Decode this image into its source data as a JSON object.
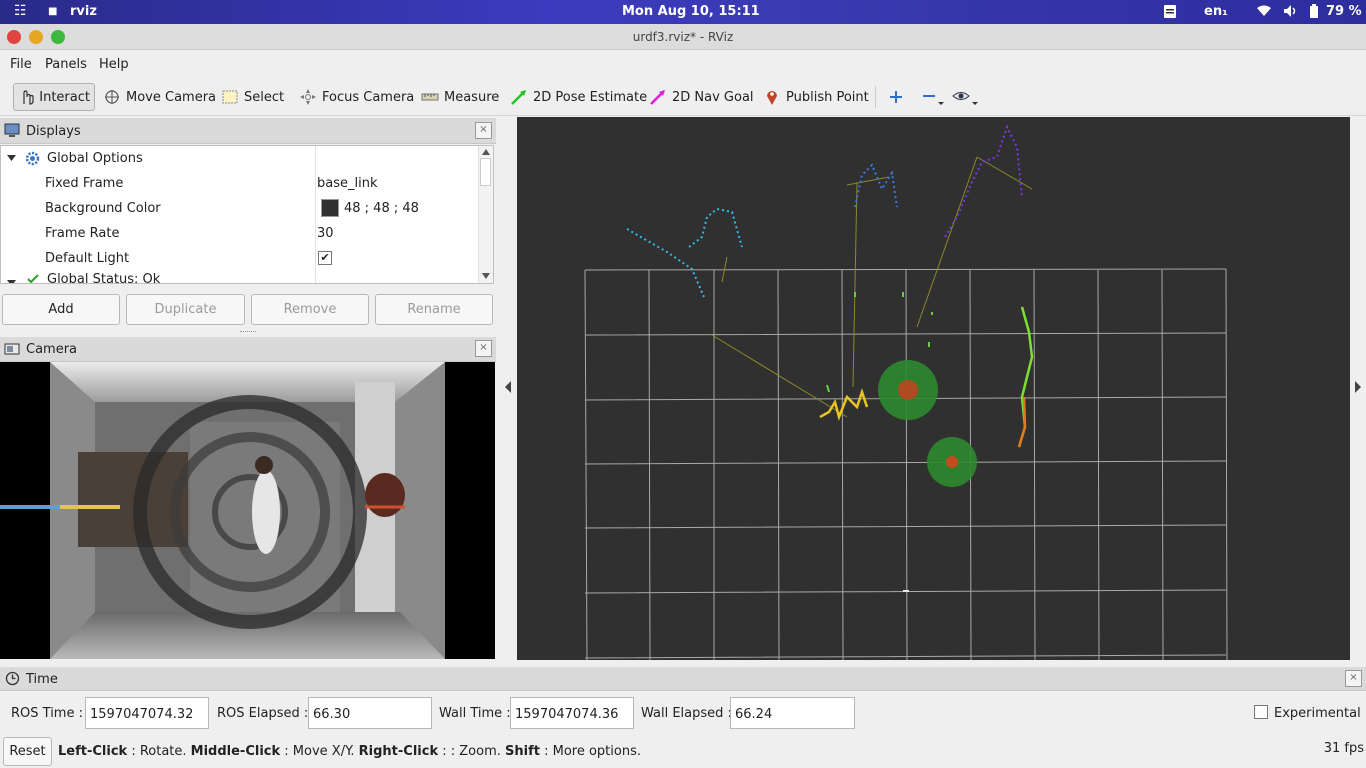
{
  "system_bar": {
    "app_name": "rviz",
    "clock": "Mon Aug 10, 15:11",
    "keyboard_layout": "en₁",
    "battery": "79 %"
  },
  "window": {
    "title": "urdf3.rviz* - RViz"
  },
  "menu": [
    "File",
    "Panels",
    "Help"
  ],
  "toolbar": {
    "interact": "Interact",
    "move_camera": "Move Camera",
    "select": "Select",
    "focus_camera": "Focus Camera",
    "measure": "Measure",
    "pose_estimate": "2D Pose Estimate",
    "nav_goal": "2D Nav Goal",
    "publish_point": "Publish Point"
  },
  "displays": {
    "title": "Displays",
    "close": "×",
    "global_options": "Global Options",
    "rows": [
      {
        "key": "Fixed Frame",
        "value": "base_link"
      },
      {
        "key": "Background Color",
        "value": "48 ; 48 ; 48"
      },
      {
        "key": "Frame Rate",
        "value": "30"
      },
      {
        "key": "Default Light",
        "value": ""
      }
    ],
    "global_status": "Global Status: Ok",
    "background_color_hex": "#303030",
    "default_light_checked": true,
    "buttons": {
      "add": "Add",
      "duplicate": "Duplicate",
      "remove": "Remove",
      "rename": "Rename"
    }
  },
  "camera_panel": {
    "title": "Camera",
    "close": "×"
  },
  "time_panel": {
    "title": "Time",
    "close": "×",
    "ros_time_label": "ROS Time :",
    "ros_time": "1597047074.32",
    "ros_elapsed_label": "ROS Elapsed :",
    "ros_elapsed": "66.30",
    "wall_time_label": "Wall Time :",
    "wall_time": "1597047074.36",
    "wall_elapsed_label": "Wall Elapsed :",
    "wall_elapsed": "66.24",
    "experimental": "Experimental",
    "experimental_checked": false
  },
  "status_bar": {
    "reset": "Reset",
    "hint_bold_1": "Left-Click",
    "hint_text_1": ": Rotate. ",
    "hint_bold_2": "Middle-Click",
    "hint_text_2": ": Move X/Y. ",
    "hint_bold_3": "Right-Click",
    "hint_text_3": ": : Zoom. ",
    "hint_bold_4": "Shift",
    "hint_text_4": ": More options.",
    "fps": "31 fps"
  }
}
